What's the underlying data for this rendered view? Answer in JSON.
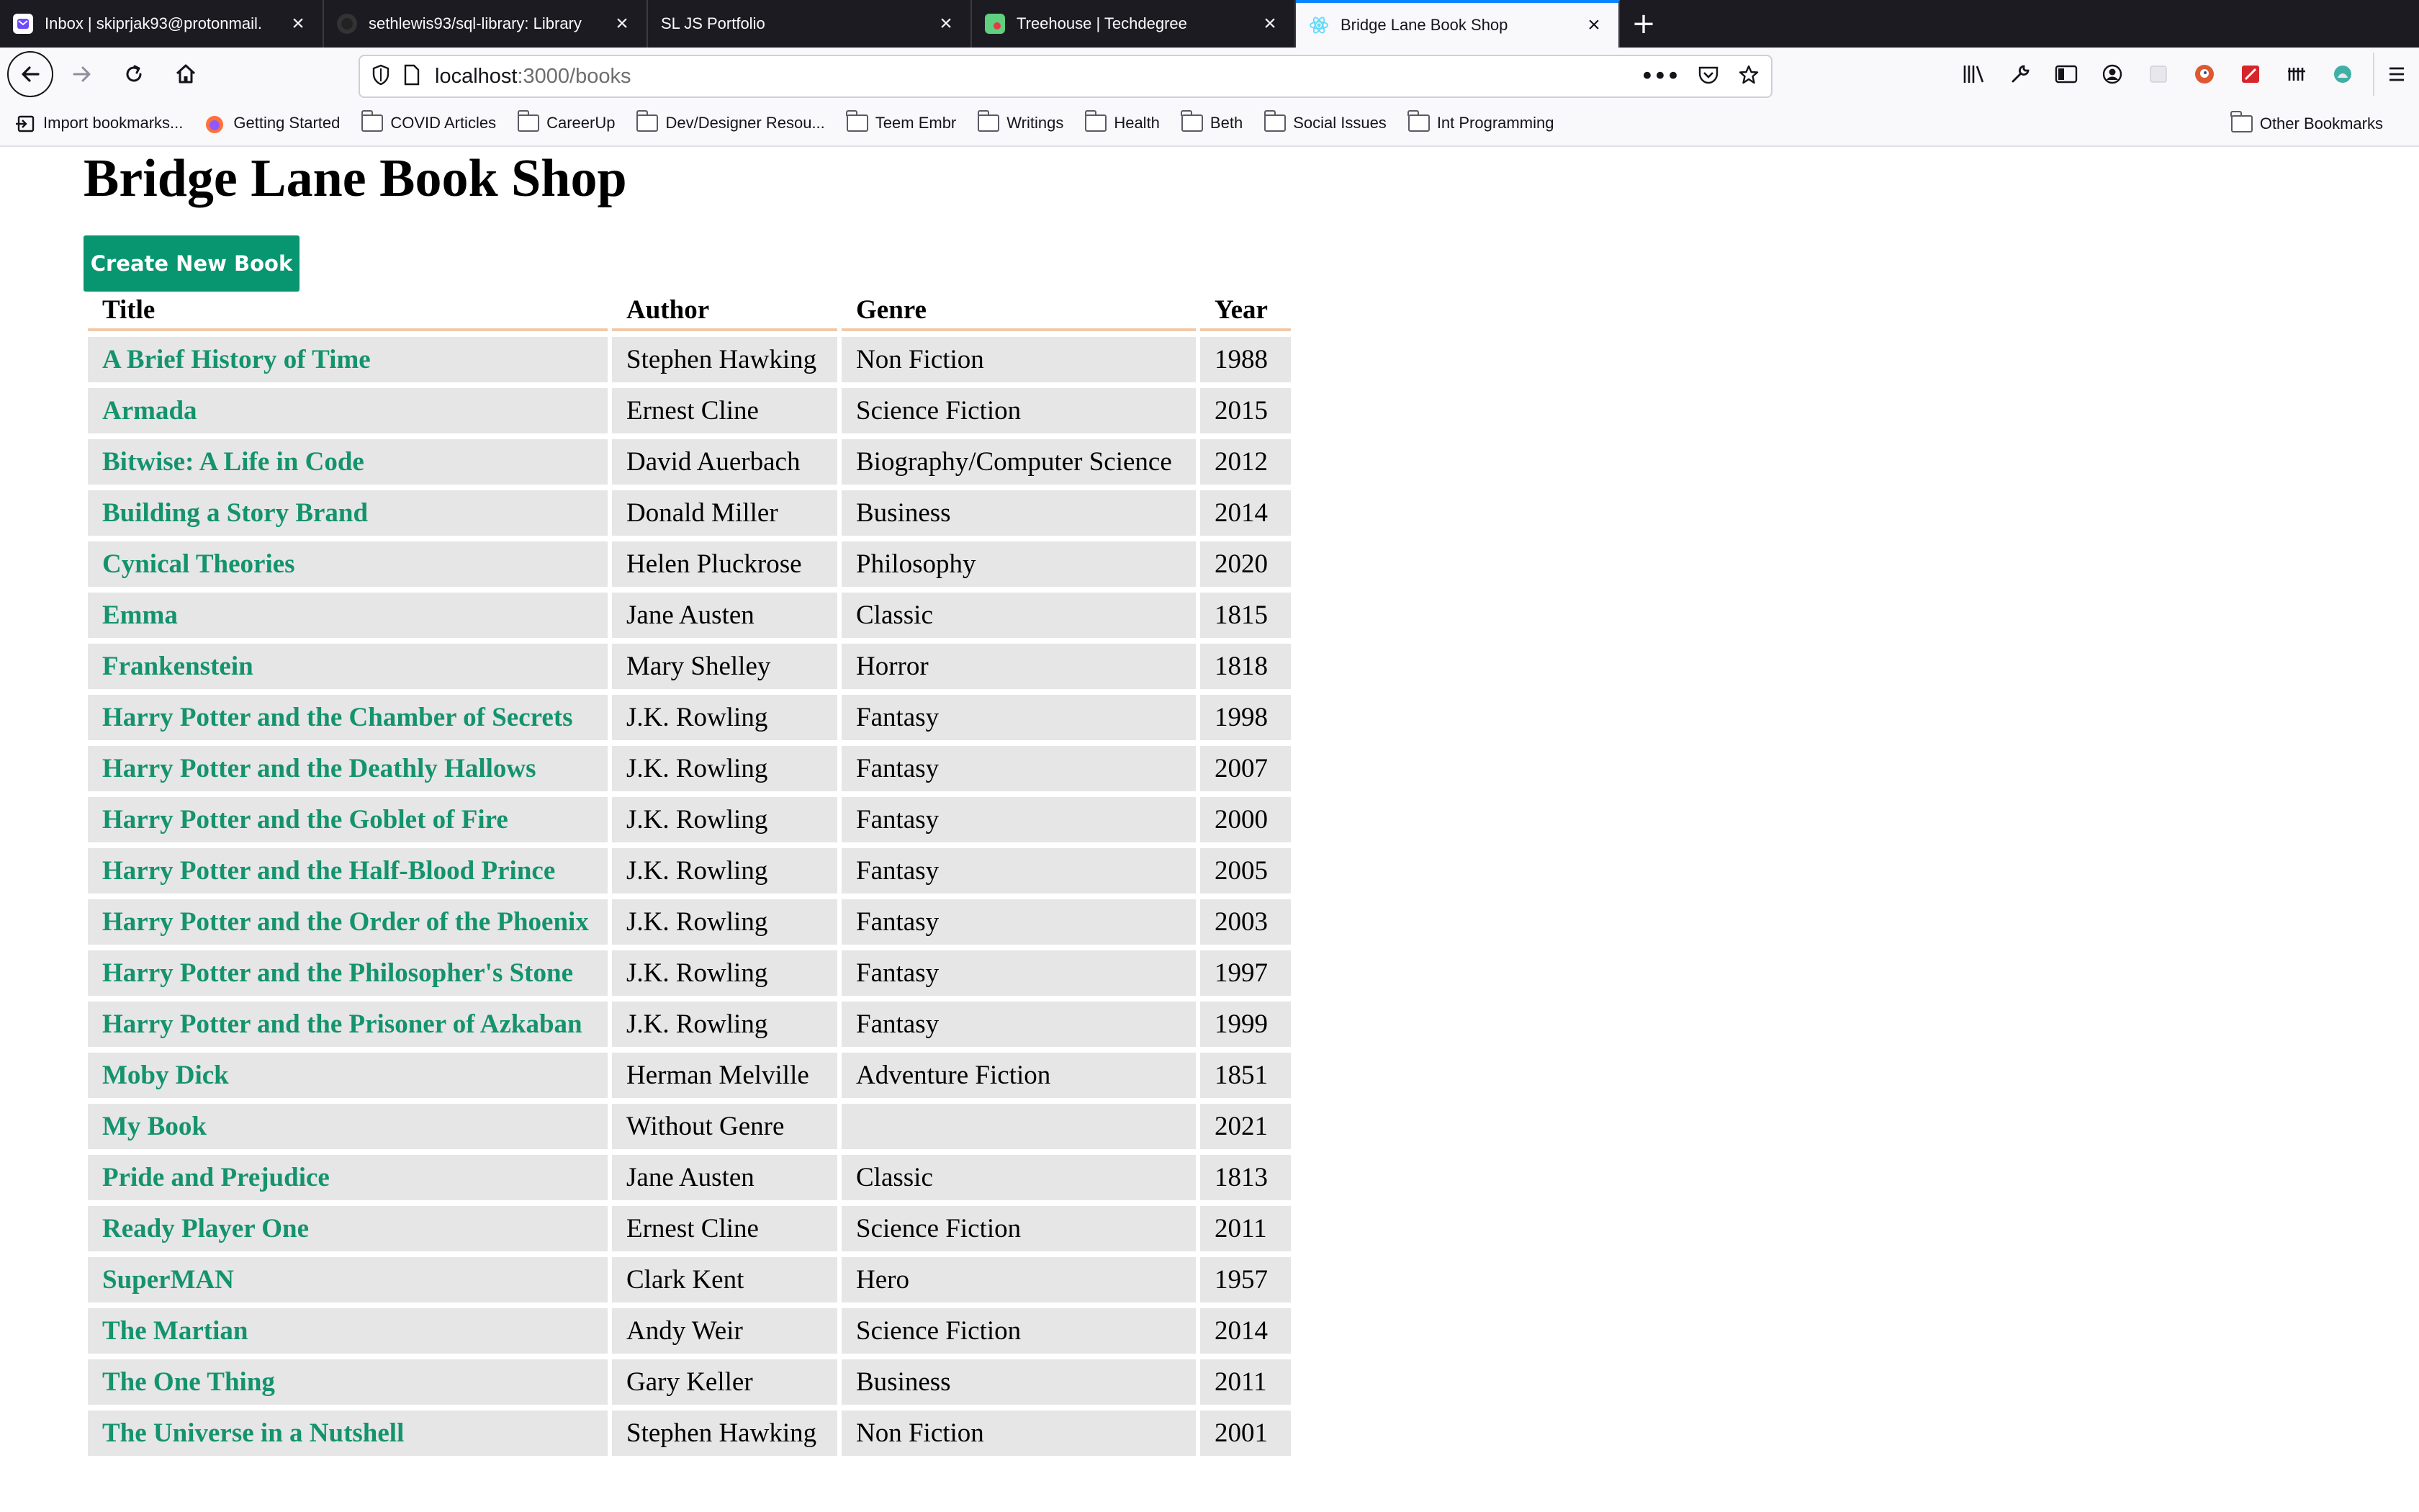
{
  "browser": {
    "tabs": [
      {
        "label": "Inbox | skiprjak93@protonmail.",
        "favicon": "protonmail-icon",
        "color": "#6d4aff",
        "active": false
      },
      {
        "label": "sethlewis93/sql-library: Library",
        "favicon": "github-icon",
        "color": "#333333",
        "active": false
      },
      {
        "label": "SL JS Portfolio",
        "favicon": "",
        "color": "",
        "active": false
      },
      {
        "label": "Treehouse | Techdegree",
        "favicon": "treehouse-icon",
        "color": "#5fcf80",
        "active": false
      },
      {
        "label": "Bridge Lane Book Shop",
        "favicon": "react-icon",
        "color": "#61dafb",
        "active": true
      }
    ],
    "url": {
      "host": "localhost",
      "path": ":3000/books"
    },
    "bookmarks": [
      {
        "label": "Import bookmarks...",
        "icon": "import-icon"
      },
      {
        "label": "Getting Started",
        "icon": "firefox-icon"
      },
      {
        "label": "COVID Articles",
        "icon": "folder-icon"
      },
      {
        "label": "CareerUp",
        "icon": "folder-icon"
      },
      {
        "label": "Dev/Designer Resou...",
        "icon": "folder-icon"
      },
      {
        "label": "Teem Embr",
        "icon": "folder-icon"
      },
      {
        "label": "Writings",
        "icon": "folder-icon"
      },
      {
        "label": "Health",
        "icon": "folder-icon"
      },
      {
        "label": "Beth",
        "icon": "folder-icon"
      },
      {
        "label": "Social Issues",
        "icon": "folder-icon"
      },
      {
        "label": "Int Programming",
        "icon": "folder-icon"
      }
    ],
    "other_bookmarks": "Other Bookmarks"
  },
  "page": {
    "title": "Bridge Lane Book Shop",
    "create_button": "Create New Book",
    "columns": [
      "Title",
      "Author",
      "Genre",
      "Year"
    ],
    "books": [
      {
        "title": "A Brief History of Time",
        "author": "Stephen Hawking",
        "genre": "Non Fiction",
        "year": "1988"
      },
      {
        "title": "Armada",
        "author": "Ernest Cline",
        "genre": "Science Fiction",
        "year": "2015"
      },
      {
        "title": "Bitwise: A Life in Code",
        "author": "David Auerbach",
        "genre": "Biography/Computer Science",
        "year": "2012"
      },
      {
        "title": "Building a Story Brand",
        "author": "Donald Miller",
        "genre": "Business",
        "year": "2014"
      },
      {
        "title": "Cynical Theories",
        "author": "Helen Pluckrose",
        "genre": "Philosophy",
        "year": "2020"
      },
      {
        "title": "Emma",
        "author": "Jane Austen",
        "genre": "Classic",
        "year": "1815"
      },
      {
        "title": "Frankenstein",
        "author": "Mary Shelley",
        "genre": "Horror",
        "year": "1818"
      },
      {
        "title": "Harry Potter and the Chamber of Secrets",
        "author": "J.K. Rowling",
        "genre": "Fantasy",
        "year": "1998"
      },
      {
        "title": "Harry Potter and the Deathly Hallows",
        "author": "J.K. Rowling",
        "genre": "Fantasy",
        "year": "2007"
      },
      {
        "title": "Harry Potter and the Goblet of Fire",
        "author": "J.K. Rowling",
        "genre": "Fantasy",
        "year": "2000"
      },
      {
        "title": "Harry Potter and the Half-Blood Prince",
        "author": "J.K. Rowling",
        "genre": "Fantasy",
        "year": "2005"
      },
      {
        "title": "Harry Potter and the Order of the Phoenix",
        "author": "J.K. Rowling",
        "genre": "Fantasy",
        "year": "2003"
      },
      {
        "title": "Harry Potter and the Philosopher's Stone",
        "author": "J.K. Rowling",
        "genre": "Fantasy",
        "year": "1997"
      },
      {
        "title": "Harry Potter and the Prisoner of Azkaban",
        "author": "J.K. Rowling",
        "genre": "Fantasy",
        "year": "1999"
      },
      {
        "title": "Moby Dick",
        "author": "Herman Melville",
        "genre": "Adventure Fiction",
        "year": "1851"
      },
      {
        "title": "My Book",
        "author": "Without Genre",
        "genre": "",
        "year": "2021"
      },
      {
        "title": "Pride and Prejudice",
        "author": "Jane Austen",
        "genre": "Classic",
        "year": "1813"
      },
      {
        "title": "Ready Player One",
        "author": "Ernest Cline",
        "genre": "Science Fiction",
        "year": "2011"
      },
      {
        "title": "SuperMAN",
        "author": "Clark Kent",
        "genre": "Hero",
        "year": "1957"
      },
      {
        "title": "The Martian",
        "author": "Andy Weir",
        "genre": "Science Fiction",
        "year": "2014"
      },
      {
        "title": "The One Thing",
        "author": "Gary Keller",
        "genre": "Business",
        "year": "2011"
      },
      {
        "title": "The Universe in a Nutshell",
        "author": "Stephen Hawking",
        "genre": "Non Fiction",
        "year": "2001"
      }
    ]
  },
  "colors": {
    "link": "#14936d",
    "button": "#07966f",
    "row_bg": "#e6e6e6",
    "header_rule": "#f0c9a8",
    "tabstrip": "#1c1b22",
    "active_tab_accent": "#0a84ff"
  }
}
